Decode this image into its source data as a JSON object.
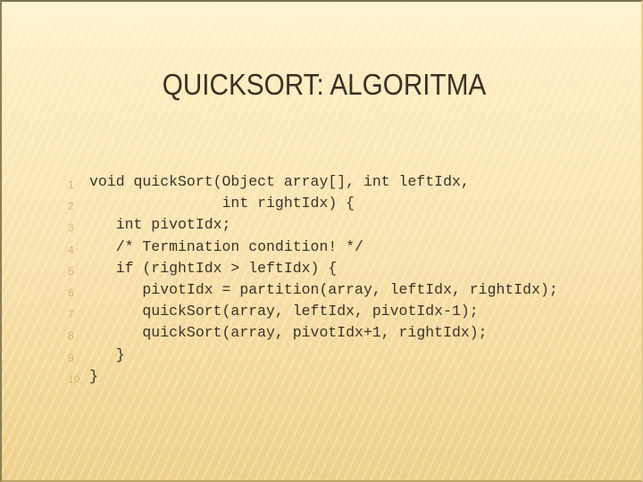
{
  "slide": {
    "title": "QUICKSORT: ALGORITMA",
    "code_lines": [
      {
        "number": "1",
        "text": "void quickSort(Object array[], int leftIdx,"
      },
      {
        "number": "2",
        "text": "               int rightIdx) {"
      },
      {
        "number": "3",
        "text": "   int pivotIdx;"
      },
      {
        "number": "4",
        "text": "   /* Termination condition! */"
      },
      {
        "number": "5",
        "text": "   if (rightIdx > leftIdx) {"
      },
      {
        "number": "6",
        "text": "      pivotIdx = partition(array, leftIdx, rightIdx);"
      },
      {
        "number": "7",
        "text": "      quickSort(array, leftIdx, pivotIdx-1);"
      },
      {
        "number": "8",
        "text": "      quickSort(array, pivotIdx+1, rightIdx);"
      },
      {
        "number": "9",
        "text": "   }"
      },
      {
        "number": "10",
        "text": "}"
      }
    ]
  },
  "colors": {
    "title": "#3b3123",
    "code_text": "#3a3226",
    "line_numbers": "#d3b574",
    "background": "#fcebbd"
  }
}
